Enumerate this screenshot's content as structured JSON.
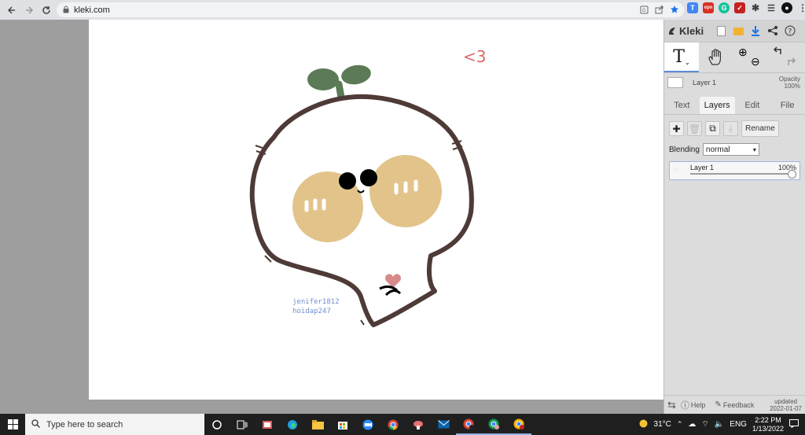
{
  "browser": {
    "url": "kleki.com"
  },
  "canvas": {
    "annotation": "<3",
    "signature_line1": "jenifer1812",
    "signature_line2": "hoidap247"
  },
  "panel": {
    "app_name": "Kleki",
    "layer_label": "Layer 1",
    "opacity_label": "Opacity",
    "opacity_value": "100%",
    "tabs": [
      {
        "label": "Text"
      },
      {
        "label": "Layers"
      },
      {
        "label": "Edit"
      },
      {
        "label": "File"
      }
    ],
    "rename_label": "Rename",
    "blending_label": "Blending",
    "blending_value": "normal",
    "layer_card": {
      "name": "Layer 1",
      "opacity": "100%"
    },
    "help_label": "Help",
    "feedback_label": "Feedback",
    "updated_label": "updated",
    "updated_date": "2022-01-07"
  },
  "taskbar": {
    "search_placeholder": "Type here to search",
    "temperature": "31°C",
    "language": "ENG",
    "time": "2:22 PM",
    "date": "1/13/2022"
  },
  "colors": {
    "outline": "#4e3a36",
    "leaf": "#5b7a55",
    "cheek": "#e2c48b",
    "heart": "#d88a8a",
    "signature": "#6f8fcf"
  }
}
